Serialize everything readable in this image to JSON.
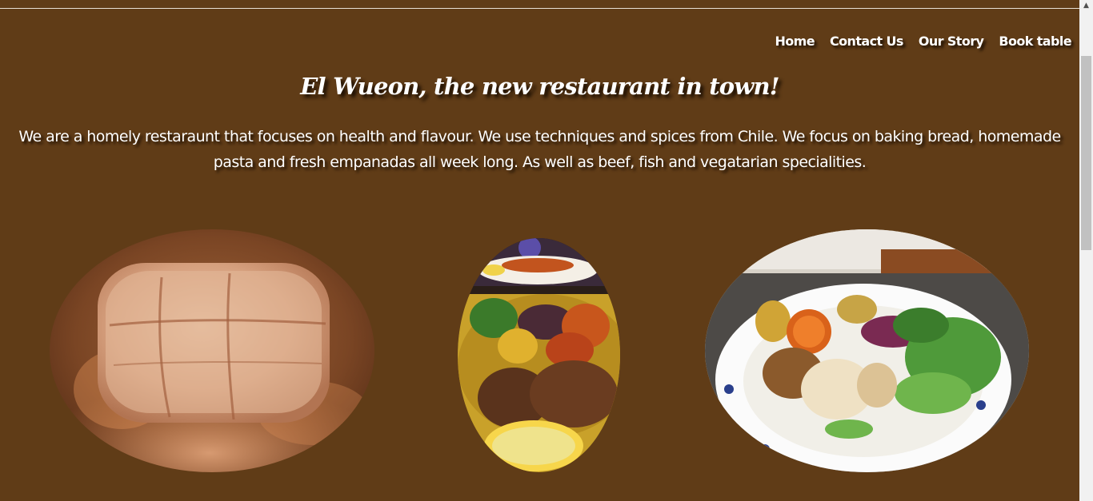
{
  "nav": {
    "items": [
      {
        "label": "Home"
      },
      {
        "label": "Contact Us"
      },
      {
        "label": "Our Story"
      },
      {
        "label": "Book table"
      }
    ]
  },
  "hero": {
    "title": "El Wueon, the new restaurant in town!",
    "description": "We are a homely restaraunt that focuses on health and flavour. We use techniques and spices from Chile. We focus on baking bread, homemade pasta and fresh empanadas all week long. As well as beef, fish and vegatarian specialities."
  },
  "gallery": {
    "images": [
      {
        "subject": "loaf of homemade bread"
      },
      {
        "subject": "plate of roasted vegetables, salad, beef and lemon"
      },
      {
        "subject": "plate of fish with roasted vegetables and salad"
      }
    ]
  },
  "colors": {
    "page_background": "#603c17",
    "text": "#ffffff",
    "text_shadow": "#1c0f03"
  },
  "scrollbar": {
    "up_arrow_icon": "triangle-up-icon"
  }
}
